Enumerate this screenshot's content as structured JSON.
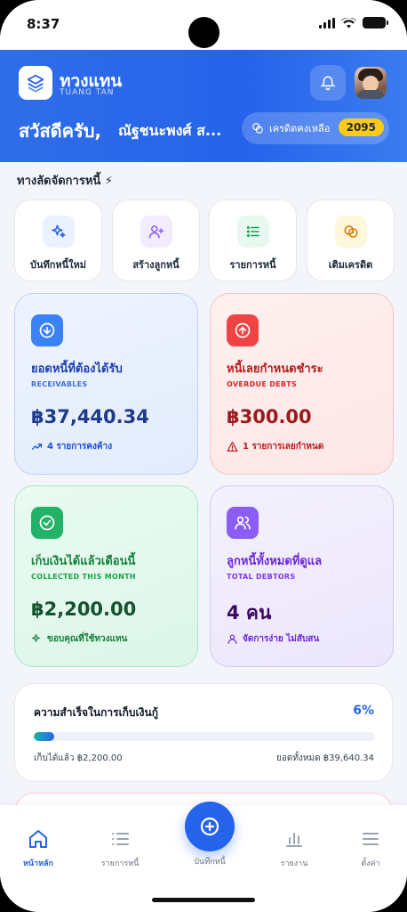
{
  "status_bar": {
    "time": "8:37"
  },
  "header": {
    "brand": "ทวงแทน",
    "brand_sub": "TUANG TAN",
    "greeting": "สวัสดีครับ,",
    "user_name": "ณัฐชนะพงศ์ ส...",
    "credit_label": "เครดิตคงเหลือ",
    "credit_value": "2095"
  },
  "shortcuts": {
    "title": "ทางลัดจัดการหนี้ ⚡",
    "items": [
      {
        "label": "บันทึกหนี้ใหม่",
        "icon": "sparkle-icon"
      },
      {
        "label": "สร้างลูกหนี้",
        "icon": "add-user-icon"
      },
      {
        "label": "รายการหนี้",
        "icon": "list-icon"
      },
      {
        "label": "เติมเครดิต",
        "icon": "coins-icon"
      }
    ]
  },
  "stats": [
    {
      "title": "ยอดหนี้ที่ต้องได้รับ",
      "subtitle": "RECEIVABLES",
      "value": "฿37,440.34",
      "footer": "4 รายการคงค้าง",
      "icon": "arrow-down-circle-icon",
      "footer_icon": "trend-up-icon"
    },
    {
      "title": "หนี้เลยกำหนดชำระ",
      "subtitle": "OVERDUE DEBTS",
      "value": "฿300.00",
      "footer": "1 รายการเลยกำหนด",
      "icon": "arrow-up-circle-icon",
      "footer_icon": "warning-icon"
    },
    {
      "title": "เก็บเงินได้แล้วเดือนนี้",
      "subtitle": "COLLECTED THIS MONTH",
      "value": "฿2,200.00",
      "footer": "ขอบคุณที่ใช้ทวงแทน",
      "icon": "check-circle-icon",
      "footer_icon": "sparkle-icon"
    },
    {
      "title": "ลูกหนี้ทั้งหมดที่ดูแล",
      "subtitle": "TOTAL DEBTORS",
      "value": "4 คน",
      "footer": "จัดการง่าย ไม่สับสน",
      "icon": "users-icon",
      "footer_icon": "user-icon"
    }
  ],
  "collection": {
    "title": "ความสำเร็จในการเก็บเงินกู้",
    "percent_label": "6%",
    "progress": 0.06,
    "collected": "เก็บได้แล้ว ฿2,200.00",
    "total": "ยอดทั้งหมด ฿39,640.34"
  },
  "tabbar": {
    "home": "หน้าหลัก",
    "debts": "รายการหนี้",
    "record": "บันทึกหนี้",
    "reports": "รายงาน",
    "settings": "ตั้งค่า"
  },
  "colors": {
    "primary": "#2563eb",
    "blue_card": "#e8f0fd",
    "red_card": "#fde9e9",
    "green_card": "#e5f8ee",
    "purple_card": "#f0edfc",
    "credit_badge": "#facc15"
  }
}
